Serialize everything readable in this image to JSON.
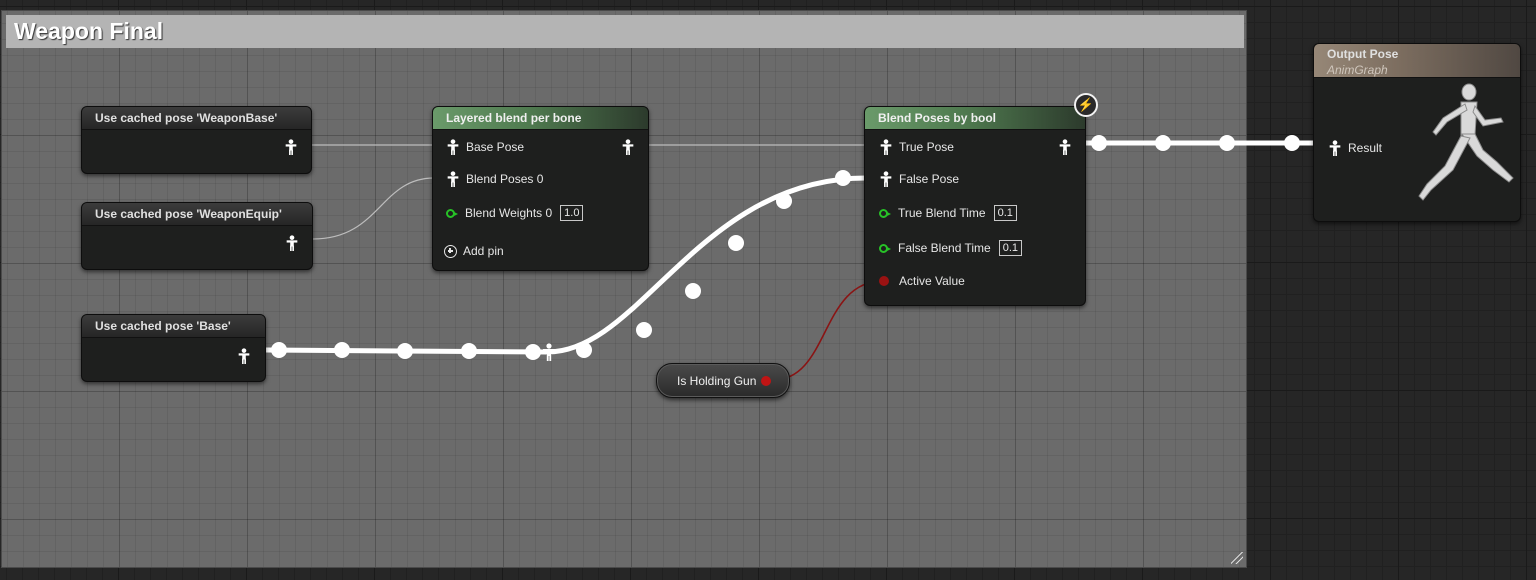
{
  "comment": {
    "title": "Weapon Final"
  },
  "nodes": {
    "cached_weapon_base": {
      "title": "Use cached pose 'WeaponBase'"
    },
    "cached_weapon_equip": {
      "title": "Use cached pose 'WeaponEquip'"
    },
    "cached_base": {
      "title": "Use cached pose 'Base'"
    },
    "layered_blend": {
      "title": "Layered blend per bone",
      "pins": {
        "base_pose": "Base Pose",
        "blend_poses": "Blend Poses 0",
        "blend_weights": "Blend Weights 0",
        "blend_weights_value": "1.0",
        "add_pin": "Add pin"
      }
    },
    "blend_by_bool": {
      "title": "Blend Poses by bool",
      "pins": {
        "true_pose": "True Pose",
        "false_pose": "False Pose",
        "true_blend_time": "True Blend Time",
        "true_blend_time_value": "0.1",
        "false_blend_time": "False Blend Time",
        "false_blend_time_value": "0.1",
        "active_value": "Active Value"
      }
    },
    "output_pose": {
      "title": "Output Pose",
      "subtitle": "AnimGraph",
      "pins": {
        "result": "Result"
      }
    },
    "is_holding_gun": {
      "title": "Is Holding Gun"
    }
  },
  "icons": {
    "pose_pin": "pose-pin-icon",
    "float_pin": "float-pin-icon",
    "bool_pin": "bool-pin-icon",
    "add_pin": "plus-circle-icon",
    "fast_path": "lightning-icon",
    "output_figure": "mannequin-running-icon"
  },
  "colors": {
    "comment_bar": "#b4b4b4",
    "blend_node_header": "#6a9a6a",
    "output_node_header": "#968777",
    "float_pin": "#27c227",
    "bool_pin": "#9a1212",
    "exec_wire": "#ffffff"
  }
}
